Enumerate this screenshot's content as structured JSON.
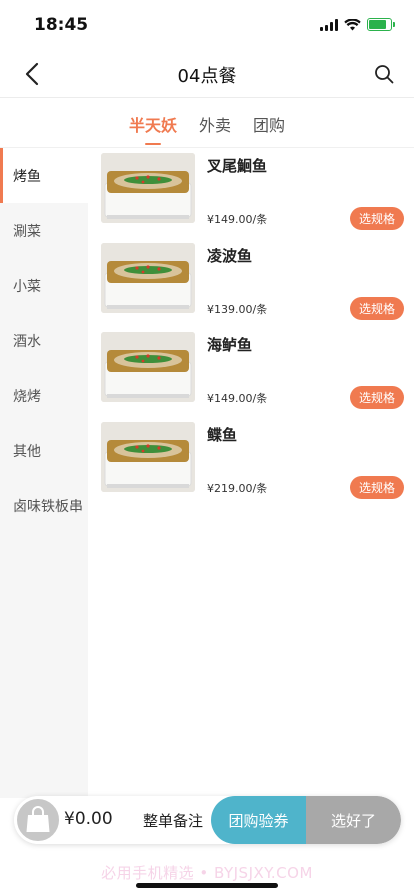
{
  "status": {
    "time": "18:45"
  },
  "nav": {
    "title": "04点餐"
  },
  "tabs": [
    {
      "label": "半天妖",
      "active": true
    },
    {
      "label": "外卖",
      "active": false
    },
    {
      "label": "团购",
      "active": false
    }
  ],
  "categories": [
    {
      "label": "烤鱼",
      "active": true
    },
    {
      "label": "涮菜",
      "active": false
    },
    {
      "label": "小菜",
      "active": false
    },
    {
      "label": "酒水",
      "active": false
    },
    {
      "label": "烧烤",
      "active": false
    },
    {
      "label": "其他",
      "active": false
    },
    {
      "label": "卤味铁板串",
      "active": false
    }
  ],
  "dishes": [
    {
      "name": "叉尾鮰鱼",
      "price": "¥149.00/条",
      "action": "选规格"
    },
    {
      "name": "凌波鱼",
      "price": "¥139.00/条",
      "action": "选规格"
    },
    {
      "name": "海鲈鱼",
      "price": "¥149.00/条",
      "action": "选规格"
    },
    {
      "name": "鲽鱼",
      "price": "¥219.00/条",
      "action": "选规格"
    }
  ],
  "bottom": {
    "total": "¥0.00",
    "remark": "整单备注",
    "voucher": "团购验券",
    "done": "选好了"
  },
  "watermark": "必用手机精选 • BYJSJXY.COM",
  "colors": {
    "accent": "#f07a50",
    "voucher": "#4fb4cb",
    "done": "#a8a8a8",
    "battery": "#2bb24c"
  }
}
